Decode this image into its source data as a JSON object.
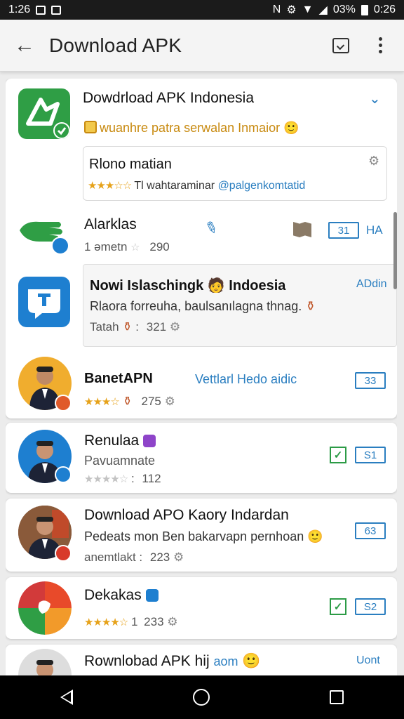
{
  "status": {
    "time": "1:26",
    "battery": "03%",
    "clock": "0:26"
  },
  "appbar": {
    "title": "Download APK"
  },
  "cards": {
    "c1": {
      "title": "Dowdrload APK Indonesia",
      "subtitle": "wuanhre patra serwalan Inmaior",
      "inner_title": "Rlono matian",
      "inner_text": "Tl wahtaraminar",
      "inner_link": "@palgenkomtatid"
    },
    "c2": {
      "title": "Alarklas",
      "meta": "1 əmetn",
      "count": "290",
      "pill": "31",
      "extra": "HA"
    },
    "c3": {
      "title": "Nowi Islaschingk",
      "title2": "Indoesia",
      "link": "ADdin",
      "desc": "Rlaora forreuha, baulsanılagna thnag.",
      "meta": "Tatah",
      "count": "321"
    },
    "c4": {
      "title": "BanetAPN",
      "link": "Vettlarl Hedo aidic",
      "count": "275",
      "pill": "33"
    },
    "c5": {
      "title": "Renulaa",
      "sub": "Pavuamnate",
      "count": "112",
      "pill": "S1"
    },
    "c6": {
      "title": "Download APO Kaory Indardan",
      "desc": "Pedeats mon Ben bakarvapn pernhoan",
      "meta": "anemtlakt",
      "count": "223",
      "pill": "63"
    },
    "c7": {
      "title": "Dekakas",
      "count": "233",
      "pill": "S2"
    },
    "c8": {
      "title": "Rownlobad APK hij",
      "title2": "aom",
      "link": "Uont"
    }
  },
  "colors": {
    "accent": "#2a7ec0",
    "green": "#2c9b46",
    "star": "#e6a21a"
  }
}
